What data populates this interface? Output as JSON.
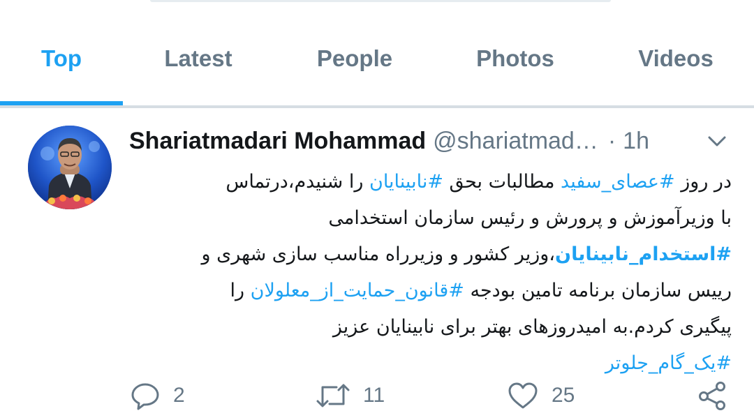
{
  "tabs": [
    {
      "label": "Top",
      "active": true
    },
    {
      "label": "Latest",
      "active": false
    },
    {
      "label": "People",
      "active": false
    },
    {
      "label": "Photos",
      "active": false
    },
    {
      "label": "Videos",
      "active": false
    }
  ],
  "tweet": {
    "display_name": "Shariatmadari Mohammad",
    "handle": "@shariatmad…",
    "separator": "·",
    "time": "1h",
    "text": {
      "l1_a": "در روز ",
      "l1_tag1": "#عصای_سفید",
      "l1_b": " مطالبات بحق ",
      "l1_tag2": "#نابینایان",
      "l1_c": " را شنیدم،درتماس",
      "l2": "با وزیرآموزش و پرورش و رئیس سازمان استخدامی",
      "l3_tag": "#استخدام_نابینایان",
      "l3_rest": "،وزیر کشور و وزیرراه مناسب سازی شهری و",
      "l4_a": "رییس سازمان برنامه تامین بودجه ",
      "l4_tag": "#قانون_حمایت_از_معلولان",
      "l4_b": " را",
      "l5": "پیگیری کردم.به امیدروزهای بهتر برای نابینایان عزیز",
      "l6_tag": "#یک_گام_جلوتر"
    },
    "actions": {
      "reply_count": "2",
      "retweet_count": "11",
      "like_count": "25"
    }
  },
  "icons": {
    "reply": "reply-icon",
    "retweet": "retweet-icon",
    "like": "heart-icon",
    "share": "share-icon",
    "caret": "chevron-down-icon"
  },
  "colors": {
    "accent": "#1da1f2",
    "muted": "#657786",
    "text": "#14171a"
  }
}
